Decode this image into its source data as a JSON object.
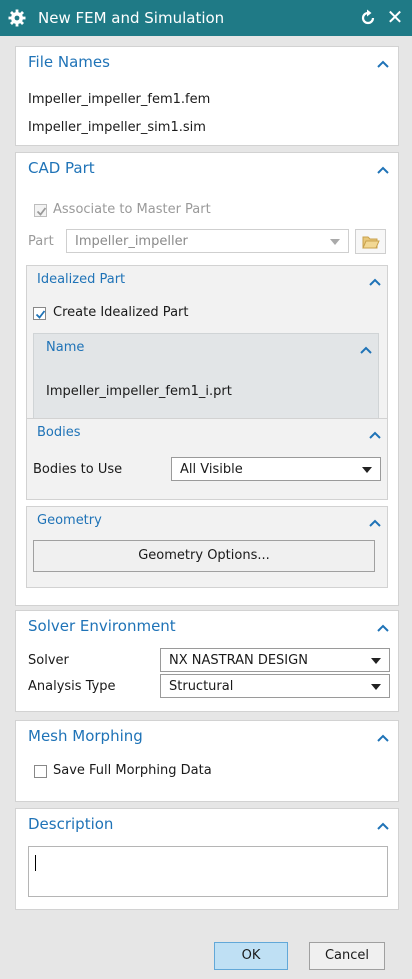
{
  "window": {
    "title": "New FEM and Simulation",
    "close_glyph": "✕",
    "titlebar_color": "#1f7a86"
  },
  "file_names": {
    "title": "File Names",
    "fem": "Impeller_impeller_fem1.fem",
    "sim": "Impeller_impeller_sim1.sim"
  },
  "cad_part": {
    "title": "CAD Part",
    "associate_label": "Associate to Master Part",
    "associate_checked": true,
    "part_label": "Part",
    "part_value": "Impeller_impeller",
    "idealized": {
      "title": "Idealized Part",
      "create_label": "Create Idealized Part",
      "create_checked": true,
      "name_header": "Name",
      "name_value": "Impeller_impeller_fem1_i.prt"
    },
    "bodies": {
      "title": "Bodies",
      "label": "Bodies to Use",
      "value": "All Visible"
    },
    "geometry": {
      "title": "Geometry",
      "button": "Geometry Options..."
    }
  },
  "solver_env": {
    "title": "Solver Environment",
    "solver_label": "Solver",
    "solver_value": "NX NASTRAN DESIGN",
    "analysis_label": "Analysis Type",
    "analysis_value": "Structural"
  },
  "mesh_morphing": {
    "title": "Mesh Morphing",
    "save_label": "Save Full Morphing Data",
    "save_checked": false
  },
  "description": {
    "title": "Description",
    "value": ""
  },
  "footer": {
    "ok": "OK",
    "cancel": "Cancel"
  },
  "colors": {
    "accent": "#1f73b7",
    "ok_button": "#bfe0f4"
  }
}
